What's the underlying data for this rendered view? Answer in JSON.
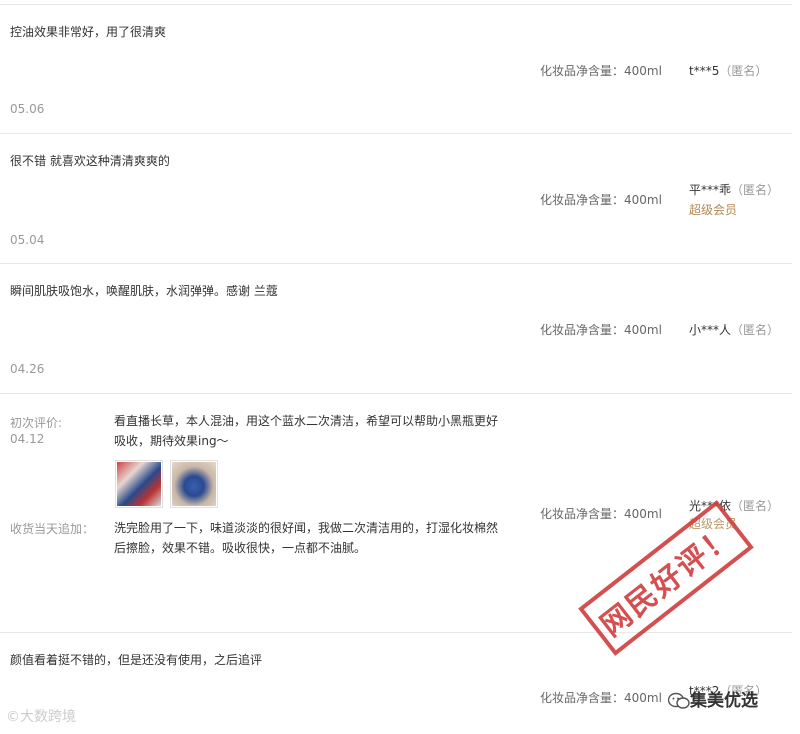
{
  "reviews": [
    {
      "text": "控油效果非常好，用了很清爽",
      "sku": "化妆品净含量：400ml",
      "user": "t***5",
      "anon": "（匿名）",
      "date": "05.06"
    },
    {
      "text": "很不错 就喜欢这种清清爽爽的",
      "sku": "化妆品净含量：400ml",
      "user": "平***乖",
      "anon": "（匿名）",
      "member": "超级会员",
      "date": "05.04"
    },
    {
      "text": "瞬间肌肤吸饱水，唤醒肌肤，水润弹弹。感谢   兰蔻",
      "sku": "化妆品净含量：400ml",
      "user": "小***人",
      "anon": "（匿名）",
      "date": "04.26"
    },
    {
      "first_label": "初次评价:",
      "first_date": "04.12",
      "first_text": "看直播长草，本人混油，用这个蓝水二次清洁，希望可以帮助小黑瓶更好吸收，期待效果ing～",
      "followup_label": "收货当天追加：",
      "followup_text": "洗完脸用了一下，味道淡淡的很好闻，我做二次清洁用的，打湿化妆棉然后擦脸，效果不错。吸收很快，一点都不油腻。",
      "sku": "化妆品净含量：400ml",
      "user": "光***依",
      "anon": "（匿名）",
      "member": "超级会员"
    },
    {
      "text": "颜值看着挺不错的，但是还没有使用，之后追评",
      "sku": "化妆品净含量：400ml",
      "user": "t***2",
      "anon": "（匿名）"
    }
  ],
  "overlays": {
    "stamp_text": "网民好评！",
    "watermark_left": "©大数跨境",
    "watermark_right": "集美优选"
  },
  "colors": {
    "stamp": "#d03c3c",
    "member": "#b38a52"
  }
}
